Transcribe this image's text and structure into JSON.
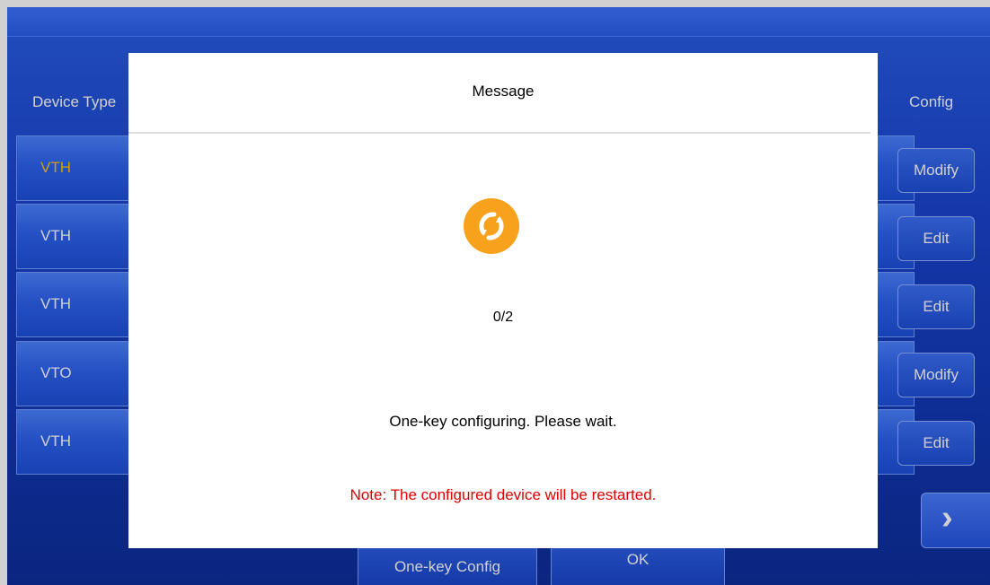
{
  "table": {
    "device_type_header": "Device Type",
    "config_header": "Config",
    "rows": [
      {
        "device_type": "VTH",
        "selected": true,
        "action": "Modify"
      },
      {
        "device_type": "VTH",
        "selected": false,
        "action": "Edit"
      },
      {
        "device_type": "VTH",
        "selected": false,
        "action": "Edit"
      },
      {
        "device_type": "VTO",
        "selected": false,
        "action": "Modify"
      },
      {
        "device_type": "VTH",
        "selected": false,
        "action": "Edit"
      }
    ]
  },
  "pagination": {
    "next_icon": "chevron-right-icon"
  },
  "bottom_bar": {
    "one_key_config_label": "One-key Config",
    "ok_label": "OK"
  },
  "dialog": {
    "title": "Message",
    "spinner_icon": "refresh-icon",
    "progress": "0/2",
    "status": "One-key configuring. Please wait.",
    "note": "Note: The configured device will be restarted."
  },
  "colors": {
    "selected_text": "#ffc400",
    "note": "#e00000",
    "spinner": "#f7a11c"
  }
}
